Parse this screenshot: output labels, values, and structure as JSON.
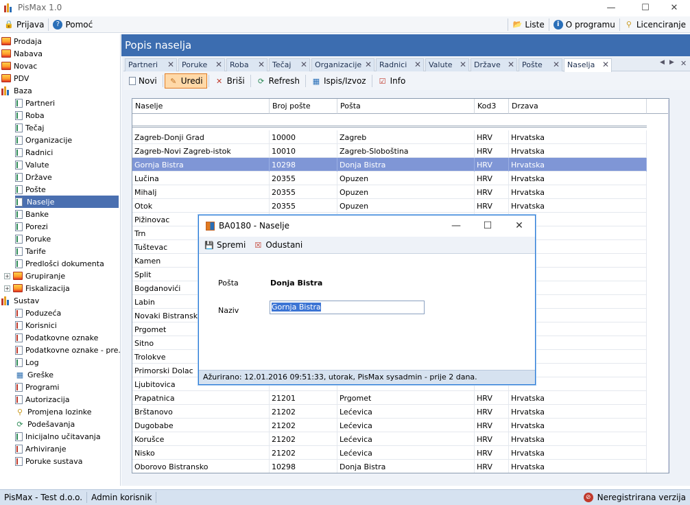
{
  "app": {
    "title": "PisMax 1.0"
  },
  "menubar": {
    "left": [
      {
        "label": "Prijava",
        "icon": "lock-icon"
      },
      {
        "label": "Pomoć",
        "icon": "help-icon"
      }
    ],
    "right": [
      {
        "label": "Liste",
        "icon": "folder-icon"
      },
      {
        "label": "O programu",
        "icon": "info-icon"
      },
      {
        "label": "Licenciranje",
        "icon": "key-icon"
      }
    ]
  },
  "sidebar": {
    "items": [
      {
        "label": "Prodaja"
      },
      {
        "label": "Nabava"
      },
      {
        "label": "Novac"
      },
      {
        "label": "PDV"
      },
      {
        "label": "Baza"
      },
      {
        "label": "Partneri"
      },
      {
        "label": "Roba"
      },
      {
        "label": "Tečaj"
      },
      {
        "label": "Organizacije"
      },
      {
        "label": "Radnici"
      },
      {
        "label": "Valute"
      },
      {
        "label": "Države"
      },
      {
        "label": "Pošte"
      },
      {
        "label": "Naselje"
      },
      {
        "label": "Banke"
      },
      {
        "label": "Porezi"
      },
      {
        "label": "Poruke"
      },
      {
        "label": "Tarife"
      },
      {
        "label": "Predlošci dokumenta"
      },
      {
        "label": "Grupiranje"
      },
      {
        "label": "Fiskalizacija"
      },
      {
        "label": "Sustav"
      },
      {
        "label": "Poduzeća"
      },
      {
        "label": "Korisnici"
      },
      {
        "label": "Podatkovne oznake"
      },
      {
        "label": "Podatkovne oznake - pre..."
      },
      {
        "label": "Log"
      },
      {
        "label": "Greške"
      },
      {
        "label": "Programi"
      },
      {
        "label": "Autorizacija"
      },
      {
        "label": "Promjena lozinke"
      },
      {
        "label": "Podešavanja"
      },
      {
        "label": "Inicijalno učitavanja"
      },
      {
        "label": "Arhiviranje"
      },
      {
        "label": "Poruke sustava"
      }
    ]
  },
  "main": {
    "title": "Popis naselja",
    "tabs": [
      {
        "label": "Partneri"
      },
      {
        "label": "Poruke"
      },
      {
        "label": "Roba"
      },
      {
        "label": "Tečaj"
      },
      {
        "label": "Organizacije"
      },
      {
        "label": "Radnici"
      },
      {
        "label": "Valute"
      },
      {
        "label": "Države"
      },
      {
        "label": "Pošte"
      },
      {
        "label": "Naselja"
      }
    ],
    "toolbar": [
      {
        "label": "Novi",
        "icon": "new-icon"
      },
      {
        "label": "Uredi",
        "icon": "edit-icon"
      },
      {
        "label": "Briši",
        "icon": "delete-icon"
      },
      {
        "label": "Refresh",
        "icon": "refresh-icon"
      },
      {
        "label": "Ispis/Izvoz",
        "icon": "print-icon"
      },
      {
        "label": "Info",
        "icon": "info-icon"
      }
    ],
    "grid": {
      "columns": [
        "Naselje",
        "Broj pošte",
        "Pošta",
        "Kod3",
        "Drzava"
      ],
      "rows": [
        [
          "Zagreb-Donji Grad",
          "10000",
          "Zagreb",
          "HRV",
          "Hrvatska"
        ],
        [
          "Zagreb-Novi Zagreb-istok",
          "10010",
          "Zagreb-Sloboština",
          "HRV",
          "Hrvatska"
        ],
        [
          "Gornja Bistra",
          "10298",
          "Donja Bistra",
          "HRV",
          "Hrvatska"
        ],
        [
          "Lučina",
          "20355",
          "Opuzen",
          "HRV",
          "Hrvatska"
        ],
        [
          "Mihalj",
          "20355",
          "Opuzen",
          "HRV",
          "Hrvatska"
        ],
        [
          "Otok",
          "20355",
          "Opuzen",
          "HRV",
          "Hrvatska"
        ],
        [
          "Pižinovac",
          "",
          "",
          "",
          ""
        ],
        [
          "Trn",
          "",
          "",
          "",
          ""
        ],
        [
          "Tuštevac",
          "",
          "",
          "",
          ""
        ],
        [
          "Kamen",
          "",
          "",
          "",
          ""
        ],
        [
          "Split",
          "",
          "",
          "",
          ""
        ],
        [
          "Bogdanovići",
          "",
          "",
          "",
          ""
        ],
        [
          "Labin",
          "",
          "",
          "",
          ""
        ],
        [
          "Novaki Bistranski",
          "",
          "",
          "",
          ""
        ],
        [
          "Prgomet",
          "",
          "",
          "",
          ""
        ],
        [
          "Sitno",
          "",
          "",
          "",
          ""
        ],
        [
          "Trolokve",
          "",
          "",
          "",
          ""
        ],
        [
          "Primorski Dolac",
          "",
          "",
          "",
          ""
        ],
        [
          "Ljubitovica",
          "",
          "",
          "",
          ""
        ],
        [
          "Prapatnica",
          "21201",
          "Prgomet",
          "HRV",
          "Hrvatska"
        ],
        [
          "Brštanovo",
          "21202",
          "Lećevica",
          "HRV",
          "Hrvatska"
        ],
        [
          "Dugobabe",
          "21202",
          "Lećevica",
          "HRV",
          "Hrvatska"
        ],
        [
          "Korušce",
          "21202",
          "Lećevica",
          "HRV",
          "Hrvatska"
        ],
        [
          "Nisko",
          "21202",
          "Lećevica",
          "HRV",
          "Hrvatska"
        ],
        [
          "Oborovo Bistransko",
          "10298",
          "Donja Bistra",
          "HRV",
          "Hrvatska"
        ]
      ]
    }
  },
  "modal": {
    "title": "BA0180 - Naselje",
    "save_label": "Spremi",
    "cancel_label": "Odustani",
    "posta_label": "Pošta",
    "posta_value": "Donja Bistra",
    "naziv_label": "Naziv",
    "naziv_value": "Gornja Bistra",
    "status": "Ažurirano: 12.01.2016 09:51:33, utorak, PisMax sysadmin -  prije 2 dana."
  },
  "statusbar": {
    "company": "PisMax - Test d.o.o.",
    "user": "Admin korisnik",
    "license": "Neregistrirana verzija"
  }
}
